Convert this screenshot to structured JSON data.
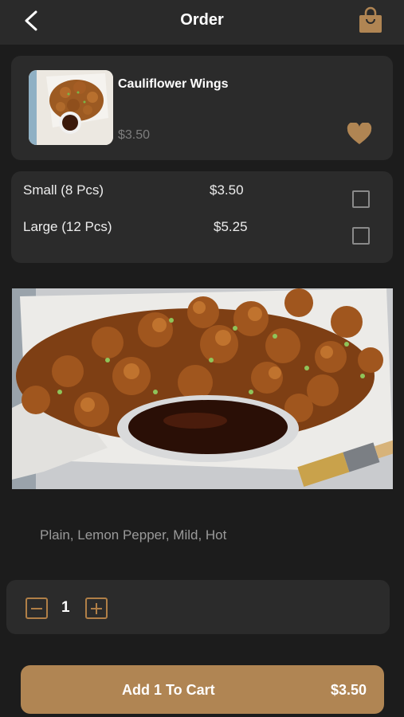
{
  "header": {
    "title": "Order",
    "back_icon": "chevron-left-icon",
    "bag_icon": "shopping-bag-icon"
  },
  "item": {
    "name": "Cauliflower Wings",
    "price": "$3.50",
    "favorite_icon": "heart-icon"
  },
  "sizes": [
    {
      "name": "Small (8 Pcs)",
      "price": "$3.50",
      "checked": false
    },
    {
      "name": "Large (12 Pcs)",
      "price": "$5.25",
      "checked": false
    }
  ],
  "flavors": "Plain, Lemon Pepper, Mild, Hot",
  "quantity": {
    "value": "1",
    "minus_icon": "minus-icon",
    "plus_icon": "plus-icon"
  },
  "cart": {
    "label": "Add 1 To Cart",
    "price": "$3.50"
  },
  "colors": {
    "background": "#1c1c1c",
    "card": "#2b2b2b",
    "accent": "#b08553",
    "muted_text": "#9a9a9a"
  }
}
